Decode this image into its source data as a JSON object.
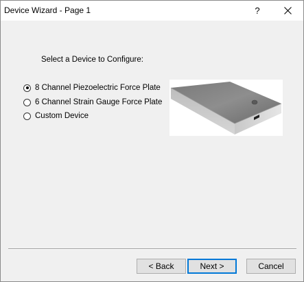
{
  "window": {
    "title": "Device Wizard - Page 1",
    "help_label": "?"
  },
  "main": {
    "prompt": "Select a Device to Configure:",
    "options": [
      {
        "label": "8 Channel Piezoelectric Force Plate",
        "selected": true
      },
      {
        "label": "6 Channel Strain Gauge Force Plate",
        "selected": false
      },
      {
        "label": "Custom Device",
        "selected": false
      }
    ]
  },
  "footer": {
    "back_label": "< Back",
    "next_label": "Next >",
    "cancel_label": "Cancel"
  },
  "icons": {
    "help": "help-icon",
    "close": "close-icon",
    "radio": "radio-icon"
  },
  "colors": {
    "accent": "#0078d7",
    "window_bg": "#f0f0f0"
  }
}
